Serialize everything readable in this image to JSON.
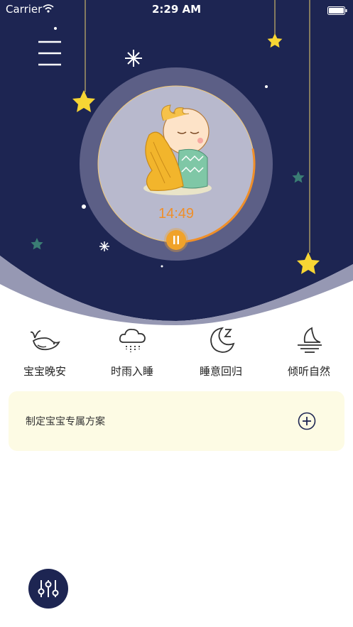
{
  "status_bar": {
    "carrier": "Carrier",
    "time": "2:29 AM"
  },
  "player": {
    "timer": "14:49",
    "progress": 0.28
  },
  "categories": [
    {
      "label": "宝宝晚安",
      "icon": "whale-icon"
    },
    {
      "label": "时雨入睡",
      "icon": "rain-cloud-icon"
    },
    {
      "label": "睡意回归",
      "icon": "moon-zzz-icon"
    },
    {
      "label": "倾听自然",
      "icon": "moon-sea-icon"
    }
  ],
  "plan": {
    "label": "制定宝宝专属方案",
    "icon": "plus-circle-icon"
  },
  "fab": {
    "icon": "mixer-sliders-icon"
  },
  "colors": {
    "night_sky": "#1d2552",
    "accent_orange": "#ef8f2a",
    "star_yellow": "#f7d534",
    "star_teal": "#3a7d74",
    "plan_background": "#fdfbe4"
  }
}
